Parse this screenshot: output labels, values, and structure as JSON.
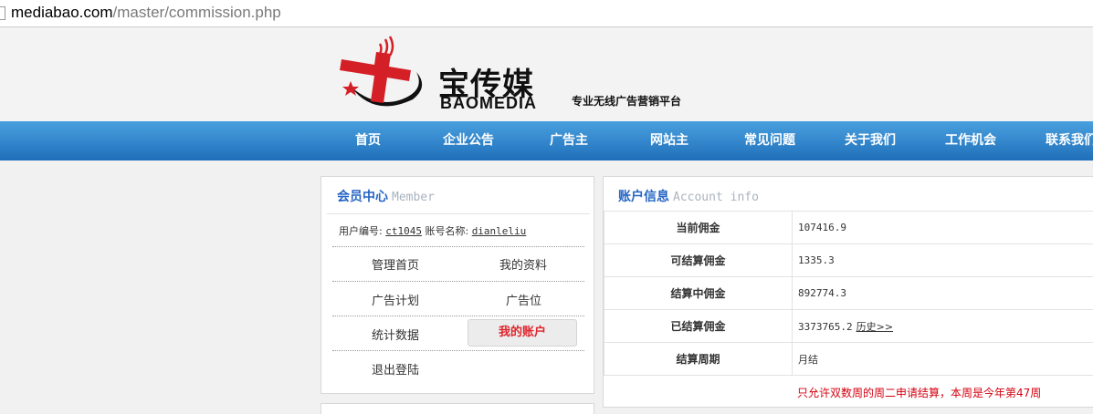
{
  "browser": {
    "url_host": "mediabao.com",
    "url_path": "/master/commission.php"
  },
  "header": {
    "logo_cn": "宝传媒",
    "logo_en": "BAOMEDIA",
    "slogan": "专业无线广告营销平台"
  },
  "nav": {
    "items": [
      "首页",
      "企业公告",
      "广告主",
      "网站主",
      "常见问题",
      "关于我们",
      "工作机会",
      "联系我们"
    ]
  },
  "member": {
    "title_cn": "会员中心",
    "title_en": "Member",
    "user_id_label": "用户编号:",
    "user_id": "ct1045",
    "account_name_label": "账号名称:",
    "account_name": "dianleliu",
    "menu": [
      "管理首页",
      "我的资料",
      "广告计划",
      "广告位",
      "统计数据",
      "我的账户",
      "退出登陆"
    ],
    "active": "我的账户"
  },
  "account": {
    "title_cn": "账户信息",
    "title_en": "Account info",
    "rows": [
      {
        "label": "当前佣金",
        "value": "107416.9"
      },
      {
        "label": "可结算佣金",
        "value": "1335.3"
      },
      {
        "label": "结算中佣金",
        "value": "892774.3"
      },
      {
        "label": "已结算佣金",
        "value": "3373765.2",
        "link": "历史>>"
      },
      {
        "label": "结算周期",
        "value": "月结"
      }
    ],
    "notice": "只允许双数周的周二申请结算，本周是今年第47周"
  },
  "colors": {
    "nav_top": "#4aa0de",
    "nav_bottom": "#1e6fba",
    "title_blue": "#2565c4",
    "alert_red": "#d4000f"
  }
}
